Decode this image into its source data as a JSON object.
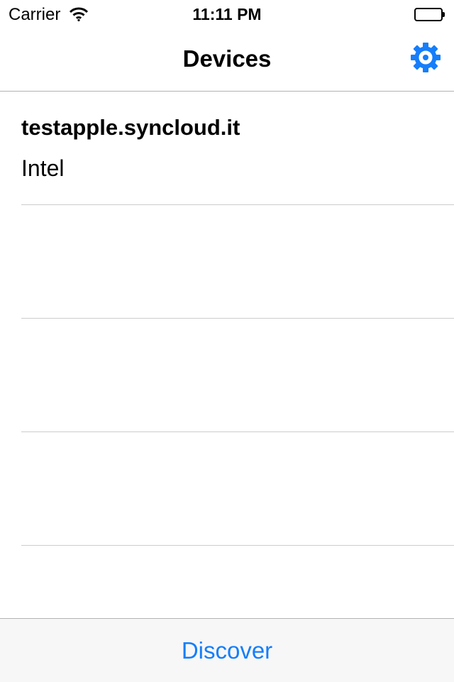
{
  "status_bar": {
    "carrier": "Carrier",
    "time": "11:11 PM",
    "wifi_icon": "wifi-icon",
    "battery_icon": "battery-icon"
  },
  "nav": {
    "title": "Devices",
    "settings_icon": "gear-icon"
  },
  "devices": [
    {
      "name": "testapple.syncloud.it",
      "detail": "Intel"
    },
    {
      "name": "",
      "detail": ""
    },
    {
      "name": "",
      "detail": ""
    },
    {
      "name": "",
      "detail": ""
    },
    {
      "name": "",
      "detail": ""
    }
  ],
  "toolbar": {
    "discover_label": "Discover"
  },
  "colors": {
    "accent": "#157efb",
    "separator": "#cccccc",
    "toolbar_bg": "#f7f7f7"
  }
}
